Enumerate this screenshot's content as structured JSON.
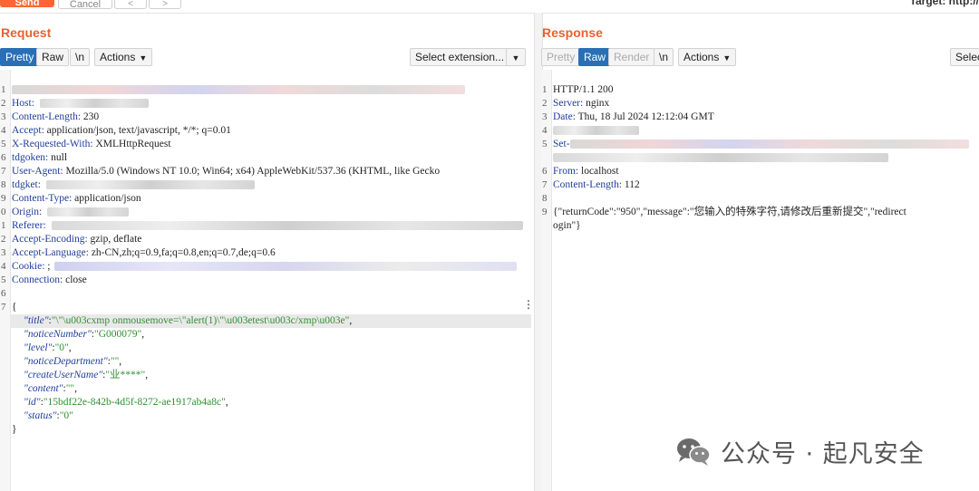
{
  "top_bar": {
    "send_label": "Send",
    "cancel_label": "Cancel",
    "back_label": "<",
    "forward_label": ">",
    "target_text": "Target: http://"
  },
  "request": {
    "title": "Request",
    "tabs": [
      "Pretty",
      "Raw",
      "\\n"
    ],
    "actions_label": "Actions",
    "extension_label": "Select extension...",
    "lines": [
      {
        "n": "1",
        "text": ""
      },
      {
        "n": "2",
        "key": "Host:",
        "val": ""
      },
      {
        "n": "3",
        "key": "Content-Length:",
        "val": " 230"
      },
      {
        "n": "4",
        "key": "Accept:",
        "val": " application/json, text/javascript, */*; q=0.01"
      },
      {
        "n": "5",
        "key": "X-Requested-With:",
        "val": " XMLHttpRequest"
      },
      {
        "n": "6",
        "key": "tdgoken:",
        "val": " null"
      },
      {
        "n": "7",
        "key": "User-Agent:",
        "val": " Mozilla/5.0 (Windows NT 10.0; Win64; x64) AppleWebKit/537.36 (KHTML, like Gecko"
      },
      {
        "n": "8",
        "key": "tdgket:",
        "val": ""
      },
      {
        "n": "9",
        "key": "Content-Type:",
        "val": " application/json"
      },
      {
        "n": "0",
        "key": "Origin:",
        "val": ""
      },
      {
        "n": "1",
        "key": "Referer:",
        "val": ""
      },
      {
        "n": "2",
        "key": "Accept-Encoding:",
        "val": " gzip, deflate"
      },
      {
        "n": "3",
        "key": "Accept-Language:",
        "val": " zh-CN,zh;q=0.9,fa;q=0.8,en;q=0.7,de;q=0.6"
      },
      {
        "n": "4",
        "key": "Cookie:",
        "val": " ;"
      },
      {
        "n": "5",
        "key": "Connection:",
        "val": " close"
      },
      {
        "n": "6",
        "text": ""
      },
      {
        "n": "7",
        "text": "{"
      }
    ],
    "body": [
      {
        "key": "\"title\"",
        "val": "\"\\\"\\u003cxmp onmousemove=\\\"alert(1)\\\"\\u003etest\\u003c/xmp\\u003e\""
      },
      {
        "key": "\"noticeNumber\"",
        "val": "\"G000079\""
      },
      {
        "key": "\"level\"",
        "val": "\"0\""
      },
      {
        "key": "\"noticeDepartment\"",
        "val": "\"\""
      },
      {
        "key": "\"createUserName\"",
        "val": "\"业****\""
      },
      {
        "key": "\"content\"",
        "val": "\"\""
      },
      {
        "key": "\"id\"",
        "val": "\"15bdf22e-842b-4d5f-8272-ae1917ab4a8c\""
      },
      {
        "key": "\"status\"",
        "val": "\"0\""
      }
    ],
    "closing_brace": "}"
  },
  "response": {
    "title": "Response",
    "tabs": [
      "Pretty",
      "Raw",
      "Render",
      "\\n"
    ],
    "actions_label": "Actions",
    "extension_label": "Select",
    "lines": [
      {
        "n": "1",
        "text": "HTTP/1.1 200"
      },
      {
        "n": "2",
        "key": "Server:",
        "val": " nginx"
      },
      {
        "n": "3",
        "key": "Date:",
        "val": " Thu, 18 Jul 2024 12:12:04 GMT"
      },
      {
        "n": "4",
        "text": ""
      },
      {
        "n": "5",
        "key": "Set-",
        "val": ""
      },
      {
        "n": "",
        "text": ""
      },
      {
        "n": "6",
        "key": "From:",
        "val": " localhost"
      },
      {
        "n": "7",
        "key": "Content-Length:",
        "val": " 112"
      },
      {
        "n": "8",
        "text": ""
      },
      {
        "n": "9",
        "text": "{\"returnCode\":\"950\",\"message\":\"您输入的特殊字符,请修改后重新提交\",\"redirect"
      },
      {
        "n": "",
        "text": "ogin\"}"
      }
    ]
  },
  "watermark": {
    "text": "公众号 · 起凡安全"
  }
}
